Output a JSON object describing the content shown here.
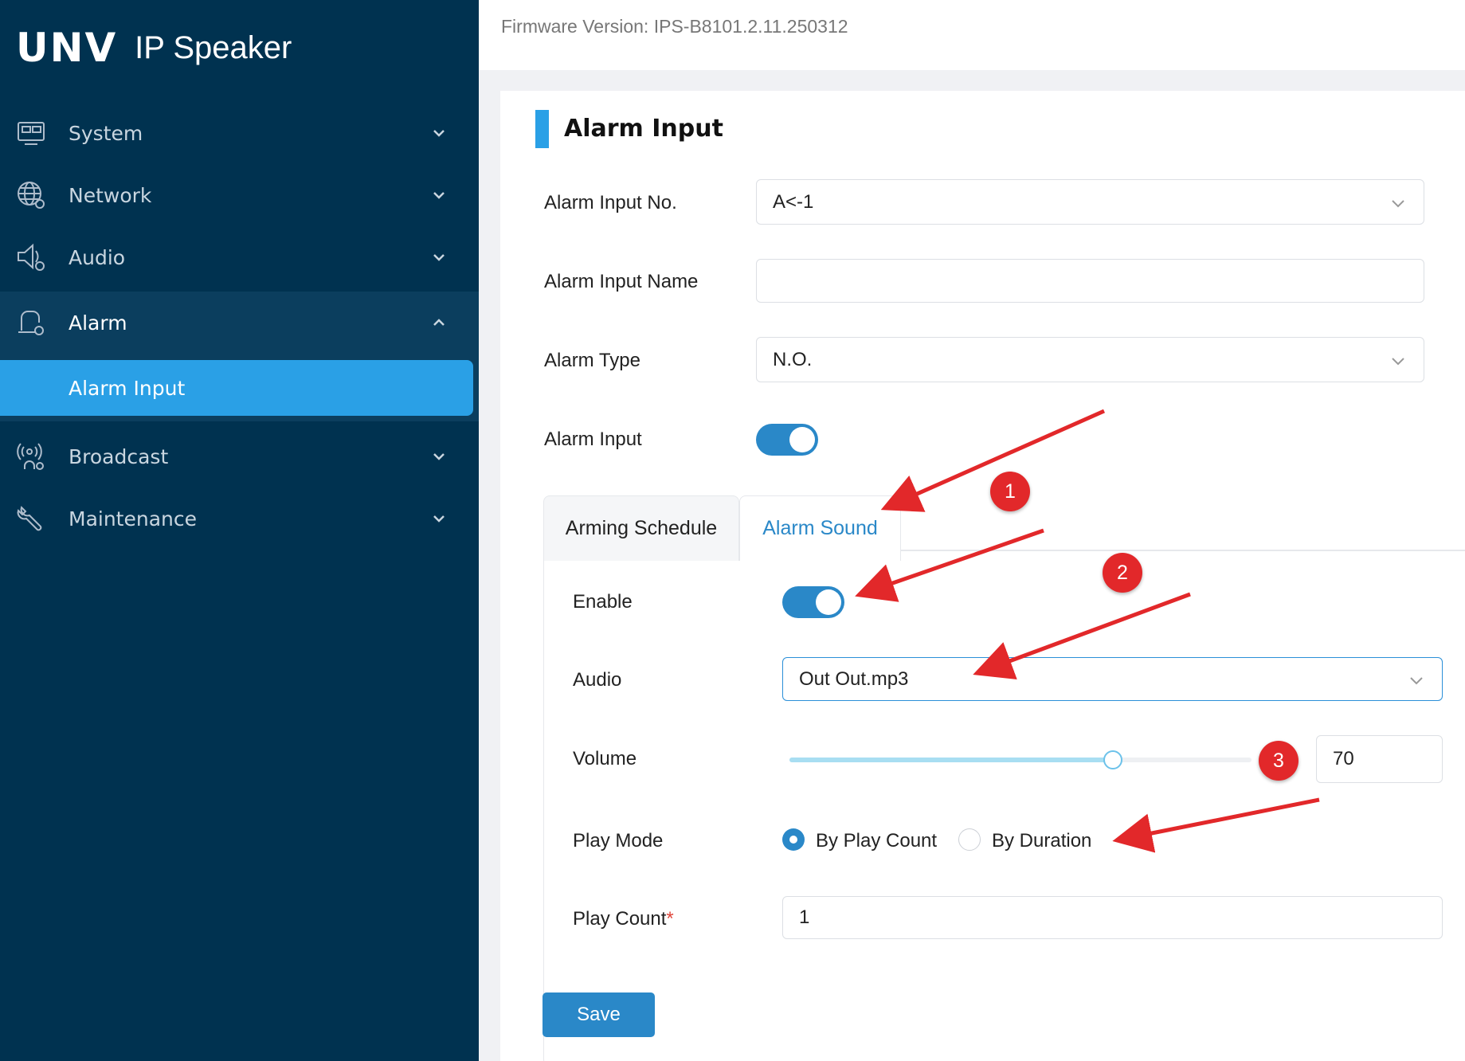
{
  "brand": {
    "logo": "UNV",
    "product": "IP Speaker"
  },
  "header": {
    "firmware": "Firmware Version: IPS-B8101.2.11.250312"
  },
  "sidebar": {
    "items": [
      {
        "label": "System",
        "icon": "monitor-icon",
        "chevron": "chevron-down-icon"
      },
      {
        "label": "Network",
        "icon": "globe-gear-icon",
        "chevron": "chevron-down-icon"
      },
      {
        "label": "Audio",
        "icon": "speaker-gear-icon",
        "chevron": "chevron-down-icon"
      },
      {
        "label": "Alarm",
        "icon": "alarm-gear-icon",
        "chevron": "chevron-up-icon"
      },
      {
        "label": "Broadcast",
        "icon": "broadcast-user-icon",
        "chevron": "chevron-down-icon"
      },
      {
        "label": "Maintenance",
        "icon": "wrench-icon",
        "chevron": "chevron-down-icon"
      }
    ],
    "active_sub": "Alarm Input"
  },
  "page": {
    "title": "Alarm Input",
    "alarm_input_no": {
      "label": "Alarm Input No.",
      "value": "A<-1"
    },
    "alarm_input_name": {
      "label": "Alarm Input Name",
      "value": ""
    },
    "alarm_type": {
      "label": "Alarm Type",
      "value": "N.O."
    },
    "alarm_input_toggle": {
      "label": "Alarm Input",
      "on": true
    }
  },
  "tabs": [
    {
      "label": "Arming Schedule",
      "active": false
    },
    {
      "label": "Alarm Sound",
      "active": true
    }
  ],
  "alarm_sound": {
    "enable": {
      "label": "Enable",
      "on": true
    },
    "audio": {
      "label": "Audio",
      "value": "Out Out.mp3"
    },
    "volume": {
      "label": "Volume",
      "value": "70",
      "percent": 70
    },
    "play_mode": {
      "label": "Play Mode",
      "options": [
        "By Play Count",
        "By Duration"
      ],
      "selected": "By Play Count"
    },
    "play_count": {
      "label": "Play Count",
      "required_mark": "*",
      "value": "1"
    }
  },
  "actions": {
    "save": "Save"
  },
  "annotations": {
    "badges": [
      "1",
      "2",
      "3"
    ],
    "color": "#e2282a"
  },
  "colors": {
    "sidebar": "#003250",
    "accent": "#2aa0e6",
    "toggle": "#2a88c8"
  }
}
